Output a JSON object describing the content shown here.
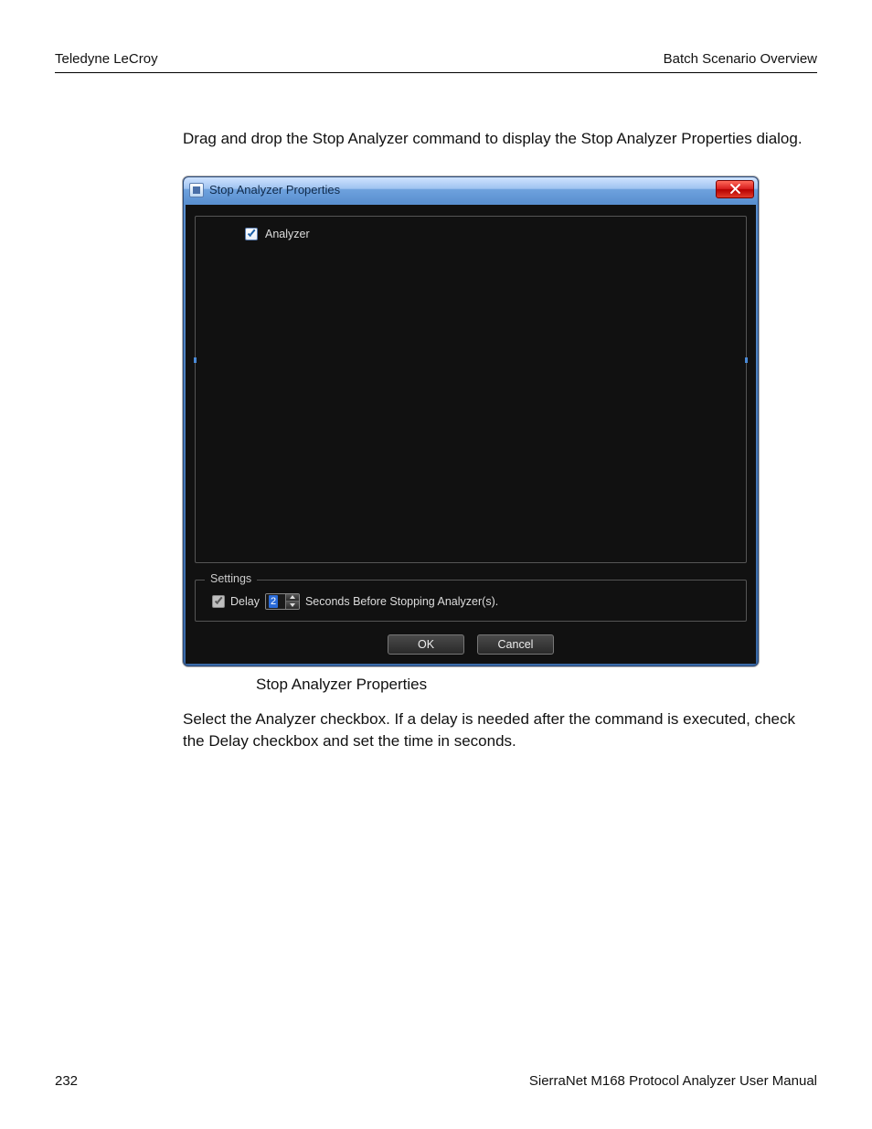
{
  "header": {
    "left": "Teledyne LeCroy",
    "right": "Batch Scenario Overview"
  },
  "intro_text": "Drag and drop the Stop Analyzer command to display the Stop Analyzer Properties dialog.",
  "dialog": {
    "title": "Stop Analyzer Properties",
    "analyzer_checkbox_label": "Analyzer",
    "settings": {
      "legend": "Settings",
      "delay_label": "Delay",
      "delay_value": "2",
      "delay_suffix": "Seconds Before Stopping Analyzer(s)."
    },
    "buttons": {
      "ok": "OK",
      "cancel": "Cancel"
    }
  },
  "caption": "Stop Analyzer Properties",
  "after_text": "Select the Analyzer checkbox. If a delay is needed after the command is executed, check the Delay checkbox and set the time in seconds.",
  "footer": {
    "page_number": "232",
    "manual_title": "SierraNet M168 Protocol Analyzer User Manual"
  }
}
